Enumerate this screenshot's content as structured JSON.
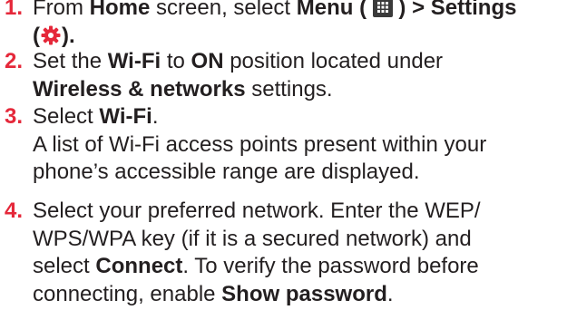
{
  "colors": {
    "accent": "#e5283a",
    "text": "#231f20"
  },
  "steps": [
    {
      "number": "1.",
      "t1": "From ",
      "b1": "Home",
      "t2": " screen, select ",
      "b2": "Menu",
      "t3": " ( ",
      "icon1": "menu-icon",
      "t4": " ) > ",
      "b3": "Settings",
      "t5": "(",
      "icon2": "gear-icon",
      "t6": ")."
    },
    {
      "number": "2.",
      "t1": "Set the ",
      "b1": "Wi-Fi",
      "t2": " to ",
      "b2": "ON",
      "t3": " position located under",
      "b3": "Wireless & networks",
      "t4": " settings."
    },
    {
      "number": "3.",
      "t1": "Select ",
      "b1": "Wi-Fi",
      "t2": ".",
      "line2": "A list of Wi-Fi access points present within your",
      "line3": "phone’s accessible range are displayed."
    },
    {
      "number": "4.",
      "line1": "Select your preferred network. Enter the WEP/",
      "line2": "WPS/WPA key (if it is a secured network) and",
      "t1": "select ",
      "b1": "Connect",
      "t2": ". To verify the password before",
      "t3": "connecting, enable ",
      "b2": "Show password",
      "t4": "."
    }
  ]
}
